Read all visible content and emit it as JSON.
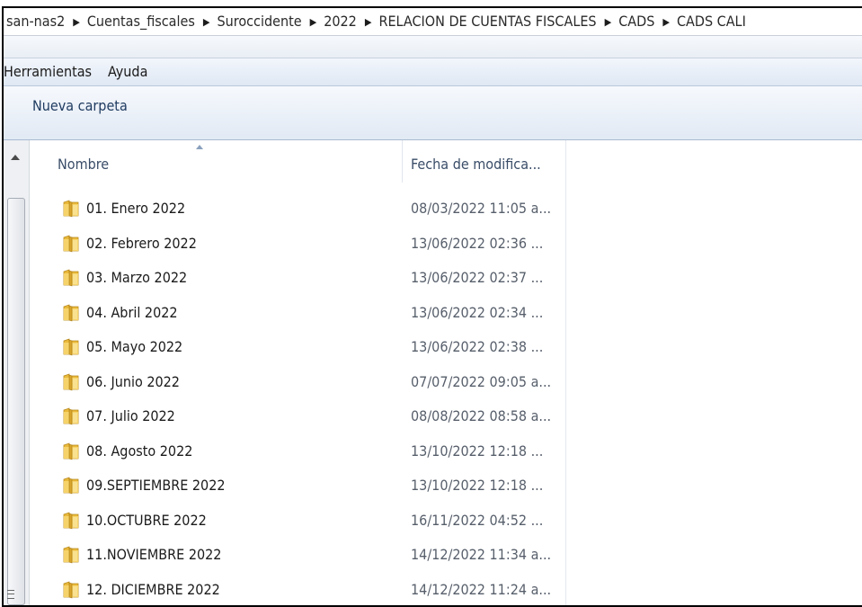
{
  "breadcrumb": [
    "san-nas2",
    "Cuentas_fiscales",
    "Suroccidente",
    "2022",
    "RELACION DE CUENTAS FISCALES",
    "CADS",
    "CADS CALI"
  ],
  "menu": [
    "Herramientas",
    "Ayuda"
  ],
  "toolbar": {
    "new_folder": "Nueva carpeta"
  },
  "columns": {
    "name": "Nombre",
    "date": "Fecha de modifica..."
  },
  "icons": {
    "folder": "folder-icon",
    "sort": "sort-ascending-icon",
    "separator": "chevron-right-icon"
  },
  "files": [
    {
      "name": "01. Enero 2022",
      "date": "08/03/2022 11:05 a..."
    },
    {
      "name": "02. Febrero 2022",
      "date": "13/06/2022 02:36 ..."
    },
    {
      "name": "03. Marzo 2022",
      "date": "13/06/2022 02:37 ..."
    },
    {
      "name": "04. Abril 2022",
      "date": "13/06/2022 02:34 ..."
    },
    {
      "name": "05. Mayo 2022",
      "date": "13/06/2022 02:38 ..."
    },
    {
      "name": "06. Junio 2022",
      "date": "07/07/2022 09:05 a..."
    },
    {
      "name": "07. Julio 2022",
      "date": "08/08/2022 08:58 a..."
    },
    {
      "name": "08. Agosto 2022",
      "date": "13/10/2022 12:18 ..."
    },
    {
      "name": "09.SEPTIEMBRE 2022",
      "date": "13/10/2022 12:18 ..."
    },
    {
      "name": "10.OCTUBRE 2022",
      "date": "16/11/2022 04:52 ..."
    },
    {
      "name": "11.NOVIEMBRE 2022",
      "date": "14/12/2022 11:34 a..."
    },
    {
      "name": "12. DICIEMBRE 2022",
      "date": "14/12/2022 11:24 a..."
    }
  ]
}
